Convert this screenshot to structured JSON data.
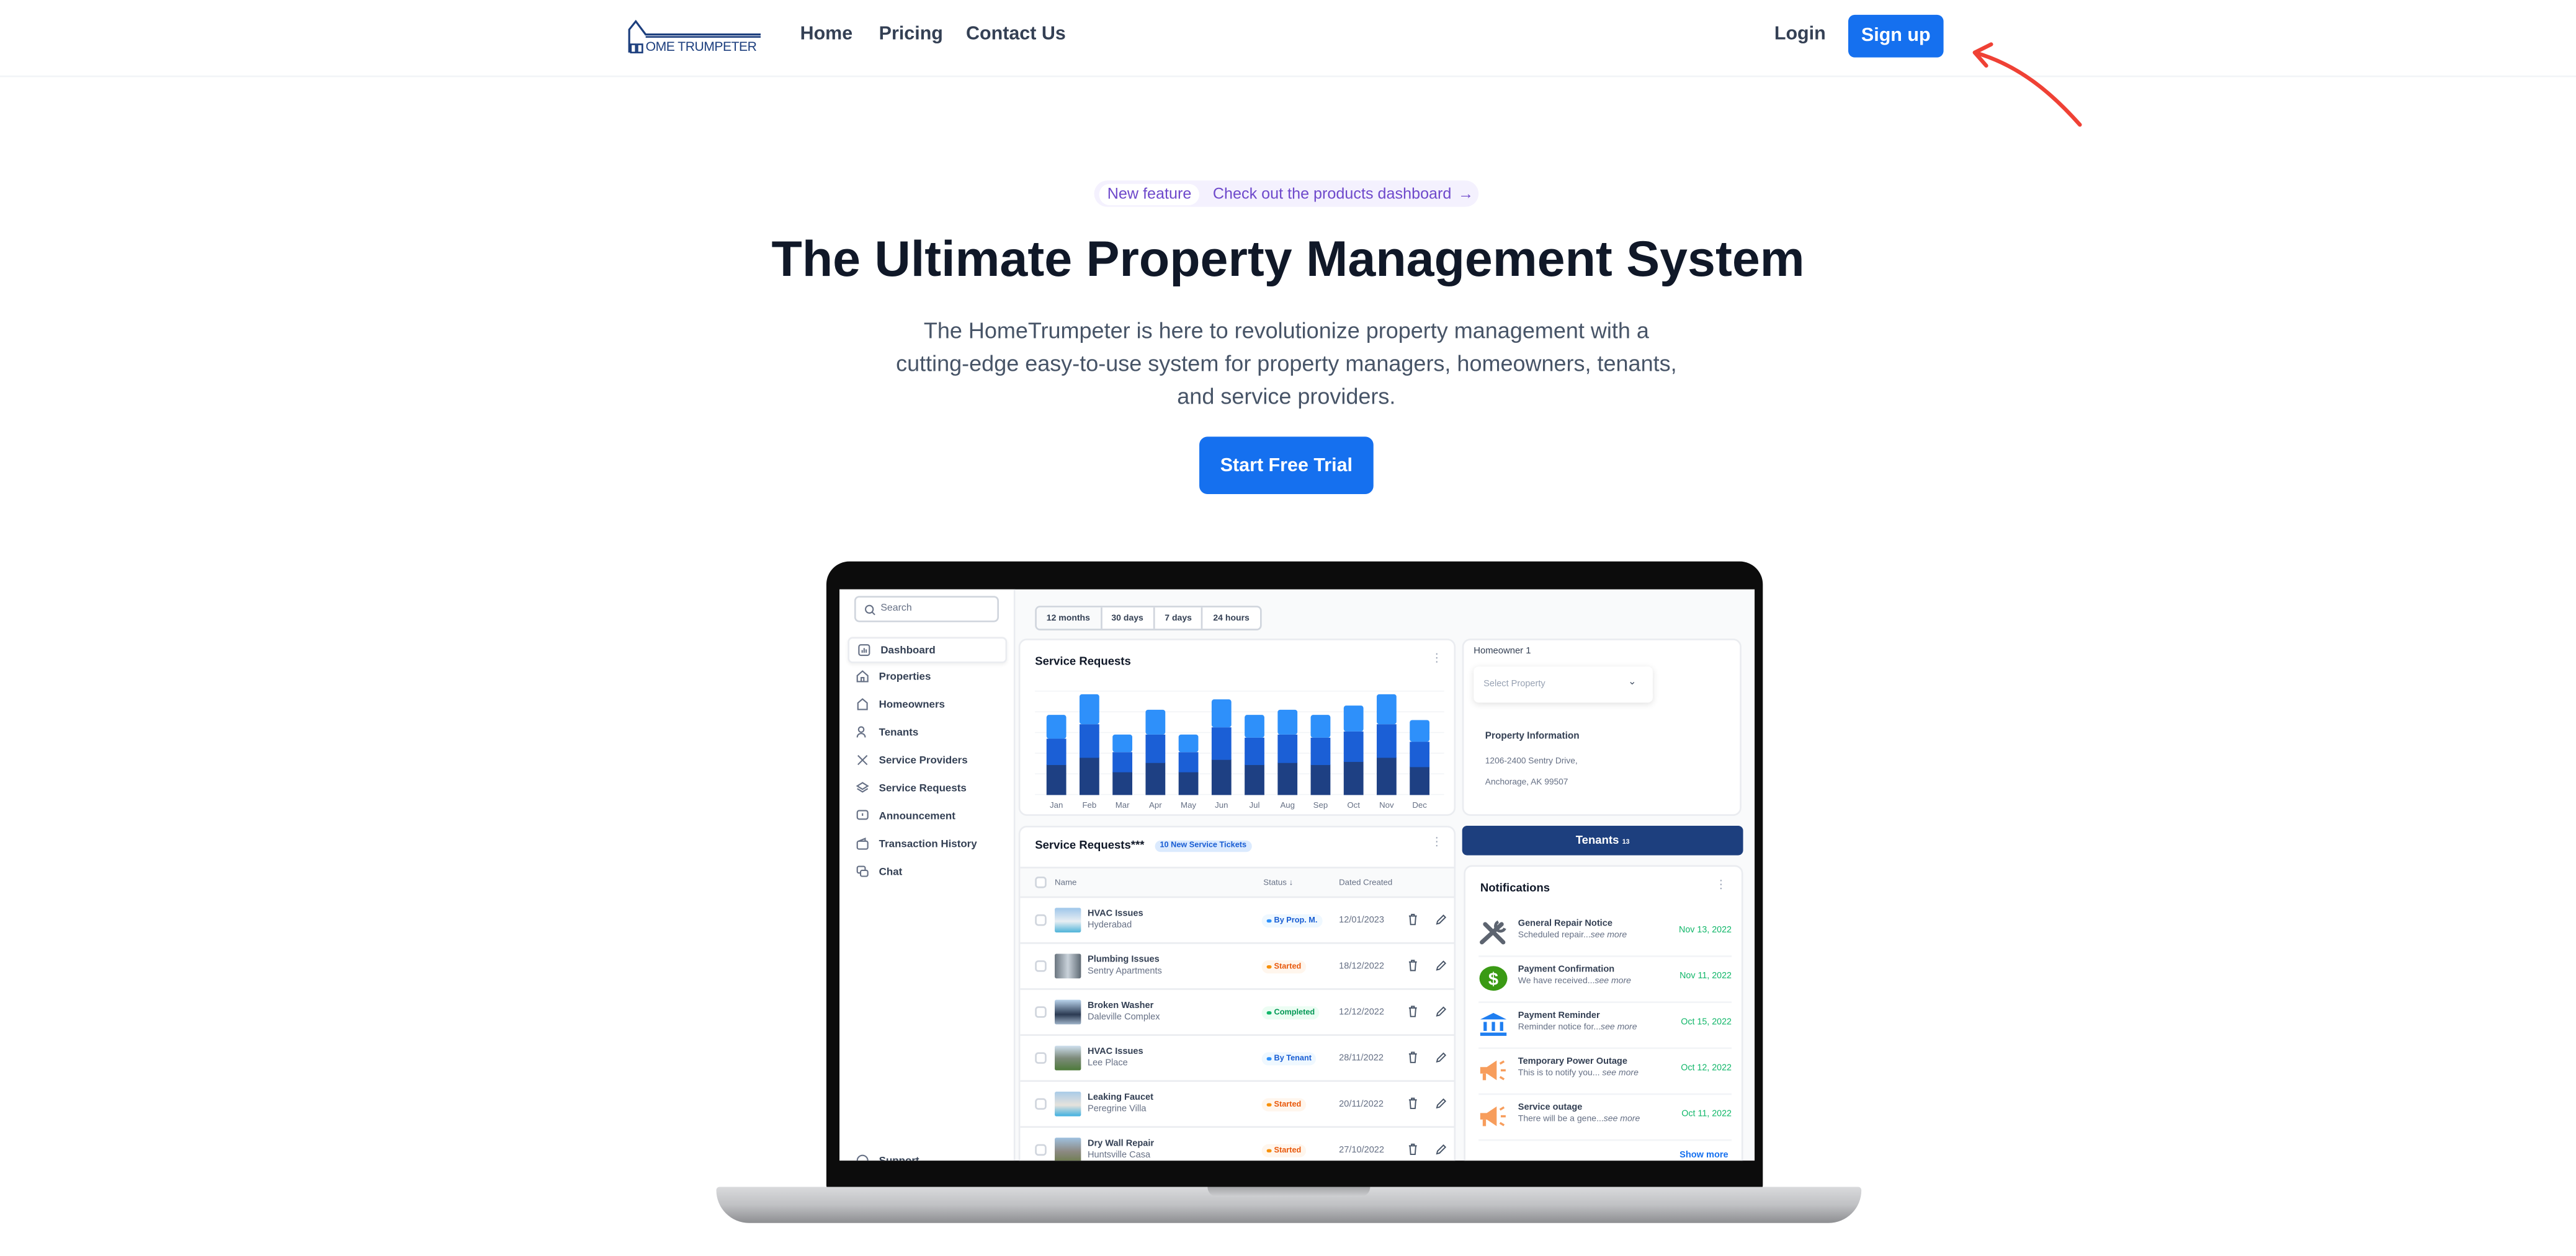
{
  "nav": {
    "logo_text": "OME TRUMPETER",
    "links": [
      "Home",
      "Pricing",
      "Contact Us"
    ],
    "login": "Login",
    "signup": "Sign up"
  },
  "hero": {
    "badge_tag": "New feature",
    "badge_text": "Check out the products dashboard",
    "title": "The Ultimate Property Management System",
    "lead": [
      "The HomeTrumpeter is here to revolutionize property management with a",
      "cutting-edge easy-to-use system for property managers, homeowners, tenants,",
      "and service providers."
    ],
    "cta": "Start Free Trial"
  },
  "colors": {
    "primary": "#1570ef",
    "arrow": "#ef4135",
    "navy": "#1d3f7e",
    "bar_dark": "#1e4083",
    "bar_mid": "#1b5fd6",
    "bar_light": "#2e90fa"
  },
  "dashboard": {
    "search_placeholder": "Search",
    "sidebar": [
      "Dashboard",
      "Properties",
      "Homeowners",
      "Tenants",
      "Service Providers",
      "Service Requests",
      "Announcement",
      "Transaction History",
      "Chat"
    ],
    "sidebar_bottom": "Support",
    "tabs": [
      "12 months",
      "30 days",
      "7 days",
      "24 hours"
    ],
    "chart_title": "Service Requests",
    "homeowner": {
      "label": "Homeowner 1",
      "select_placeholder": "Select Property",
      "info_title": "Property Information",
      "address1": "1206-2400 Sentry Drive,",
      "address2": "Anchorage, AK 99507"
    },
    "tenants_button": "Tenants",
    "tenants_count": "13",
    "table": {
      "title": "Service Requests***",
      "badge": "10 New Service Tickets",
      "headers": [
        "Name",
        "Status",
        "Dated Created"
      ],
      "rows": [
        {
          "name": "HVAC Issues",
          "place": "Hyderabad",
          "status": "By Prop. M.",
          "kind": "blue",
          "date": "12/01/2023"
        },
        {
          "name": "Plumbing Issues",
          "place": "Sentry Apartments",
          "status": "Started",
          "kind": "orange",
          "date": "18/12/2022"
        },
        {
          "name": "Broken Washer",
          "place": "Daleville Complex",
          "status": "Completed",
          "kind": "green",
          "date": "12/12/2022"
        },
        {
          "name": "HVAC Issues",
          "place": "Lee Place",
          "status": "By Tenant",
          "kind": "blue",
          "date": "28/11/2022"
        },
        {
          "name": "Leaking Faucet",
          "place": "Peregrine Villa",
          "status": "Started",
          "kind": "orange",
          "date": "20/11/2022"
        },
        {
          "name": "Dry Wall Repair",
          "place": "Huntsville Casa",
          "status": "Started",
          "kind": "orange",
          "date": "27/10/2022"
        }
      ]
    },
    "notifications": {
      "title": "Notifications",
      "items": [
        {
          "icon": "tools-icon",
          "title": "General Repair Notice",
          "sub": "Scheduled repair...",
          "more": "see more",
          "date": "Nov 13, 2022"
        },
        {
          "icon": "dollar-icon",
          "title": "Payment Confirmation",
          "sub": "We have received...",
          "more": "see more",
          "date": "Nov 11, 2022"
        },
        {
          "icon": "bank-icon",
          "title": "Payment Reminder",
          "sub": "Reminder notice for...",
          "more": "see more",
          "date": "Oct 15, 2022"
        },
        {
          "icon": "megaphone-icon",
          "title": "Temporary Power Outage",
          "sub": "This is to notify you... ",
          "more": "see more",
          "date": "Oct 12, 2022"
        },
        {
          "icon": "megaphone-icon",
          "title": "Service outage",
          "sub": "There will be a gene...",
          "more": "see more",
          "date": "Oct 11, 2022"
        }
      ],
      "show_more": "Show more"
    }
  },
  "chart_data": {
    "type": "bar",
    "stacked": true,
    "title": "Service Requests",
    "categories": [
      "Jan",
      "Feb",
      "Mar",
      "Apr",
      "May",
      "Jun",
      "Jul",
      "Aug",
      "Sep",
      "Oct",
      "Nov",
      "Dec"
    ],
    "series": [
      {
        "values": [
          29,
          36,
          22,
          31,
          22,
          34,
          29,
          31,
          29,
          32,
          36,
          27
        ],
        "color": "#1e4083"
      },
      {
        "values": [
          25,
          32,
          19,
          27,
          19,
          31,
          26,
          27,
          26,
          29,
          32,
          24
        ],
        "color": "#1b5fd6"
      },
      {
        "values": [
          23,
          29,
          17,
          24,
          17,
          27,
          22,
          24,
          22,
          25,
          29,
          21
        ],
        "color": "#2e90fa"
      }
    ],
    "ylim": [
      0,
      100
    ],
    "grid": true,
    "legend": "none"
  }
}
